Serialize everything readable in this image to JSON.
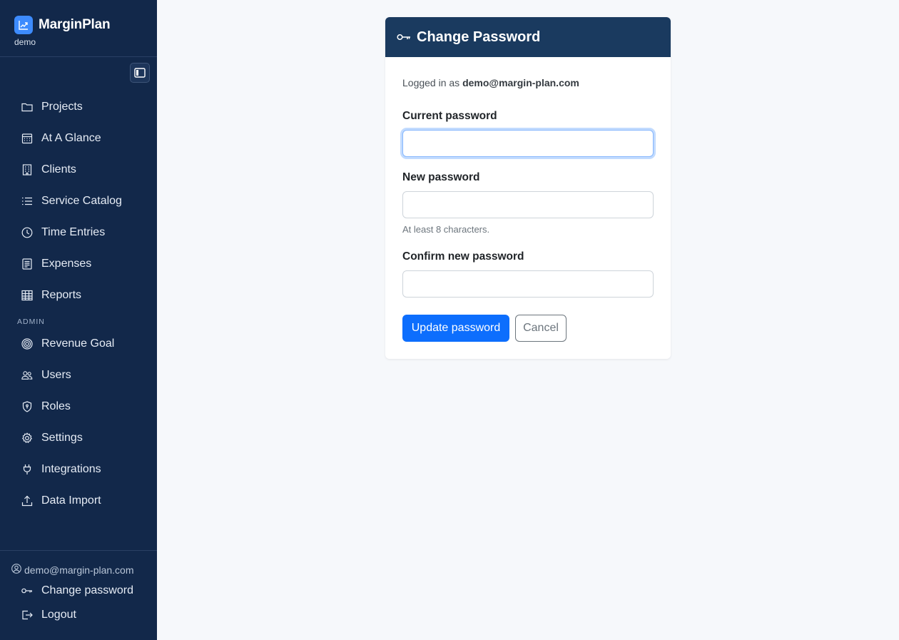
{
  "brand": {
    "name": "MarginPlan",
    "sub": "demo"
  },
  "nav": {
    "items": [
      {
        "label": "Projects",
        "icon": "folder-icon"
      },
      {
        "label": "At A Glance",
        "icon": "calendar-icon"
      },
      {
        "label": "Clients",
        "icon": "building-icon"
      },
      {
        "label": "Service Catalog",
        "icon": "list-icon"
      },
      {
        "label": "Time Entries",
        "icon": "clock-icon"
      },
      {
        "label": "Expenses",
        "icon": "receipt-icon"
      },
      {
        "label": "Reports",
        "icon": "table-icon"
      }
    ],
    "admin_label": "ADMIN",
    "admin_items": [
      {
        "label": "Revenue Goal",
        "icon": "target-icon"
      },
      {
        "label": "Users",
        "icon": "users-icon"
      },
      {
        "label": "Roles",
        "icon": "shield-icon"
      },
      {
        "label": "Settings",
        "icon": "gear-icon"
      },
      {
        "label": "Integrations",
        "icon": "plug-icon"
      },
      {
        "label": "Data Import",
        "icon": "upload-icon"
      }
    ]
  },
  "user": {
    "email": "demo@margin-plan.com",
    "change_password": "Change password",
    "logout": "Logout"
  },
  "card": {
    "title": "Change Password",
    "logged_in_prefix": "Logged in as",
    "logged_in_email": "demo@margin-plan.com",
    "current_label": "Current password",
    "current_value": "",
    "new_label": "New password",
    "new_value": "",
    "new_hint": "At least 8 characters.",
    "confirm_label": "Confirm new password",
    "confirm_value": "",
    "update_button": "Update password",
    "cancel_button": "Cancel"
  },
  "colors": {
    "sidebar": "#12284a",
    "card_header": "#1a3a5f",
    "primary": "#0d6efd",
    "brand_logo": "#3d8bfd"
  }
}
